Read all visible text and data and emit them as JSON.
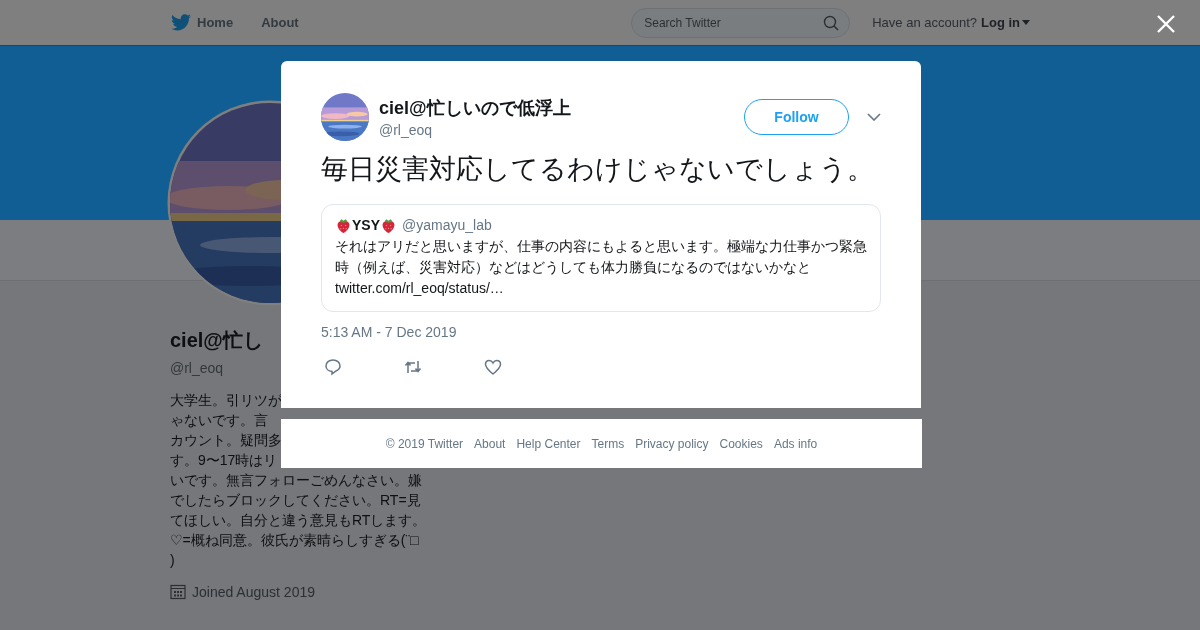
{
  "nav": {
    "items": [
      {
        "label": "Home",
        "kind": "home"
      },
      {
        "label": "About",
        "kind": "plain"
      }
    ],
    "search": {
      "placeholder": "Search Twitter"
    },
    "account_prompt": "Have an account?",
    "login": "Log in"
  },
  "profile": {
    "name": "ciel@忙し",
    "handle": "@rl_eoq",
    "bio_lines": [
      "大学生。引リツが",
      "ゃないです。言",
      "カウント。疑問多",
      "す。9〜17時はリ",
      "いです。無言フォローごめんなさい。嫌",
      "でしたらブロックしてください。RT=見",
      "てほしい。自分と違う意見もRTします。",
      "♡=概ね同意。彼氏が素晴らしすぎる(¨□",
      ")"
    ],
    "joined": "Joined August 2019"
  },
  "tweet": {
    "name": "ciel@忙しいので低浮上",
    "handle": "@rl_eoq",
    "follow": "Follow",
    "text": "毎日災害対応してるわけじゃないでしょう。",
    "quote": {
      "name": "YSY",
      "handle": "@yamayu_lab",
      "text": "それはアリだと思いますが、仕事の内容にもよると思います。極端な力仕事かつ緊急時（例えば、災害対応）などはどうしても体力勝負になるのではないかなと",
      "link": "twitter.com/rl_eoq/status/…"
    },
    "time": "5:13 AM - 7 Dec 2019"
  },
  "footer": [
    "© 2019 Twitter",
    "About",
    "Help Center",
    "Terms",
    "Privacy policy",
    "Cookies",
    "Ads info"
  ]
}
